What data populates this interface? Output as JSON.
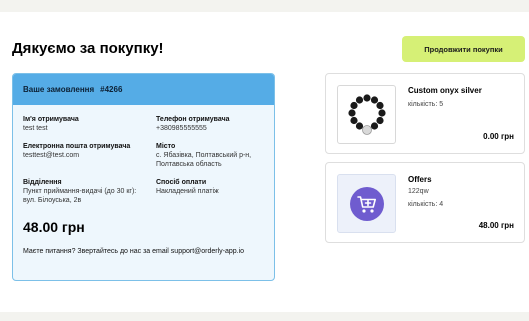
{
  "header": {
    "title": "Дякуємо за покупку!",
    "continue_label": "Продовжити покупки"
  },
  "order": {
    "heading": "Ваше замовлення",
    "number": "#4266",
    "recipient_label": "Ім'я отримувача",
    "recipient_value": "test test",
    "phone_label": "Телефон отримувача",
    "phone_value": "+380985555555",
    "email_label": "Електронна пошта отримувача",
    "email_value": "testtest@test.com",
    "city_label": "Місто",
    "city_value": "с. Ябазівка, Полтавський р-н, Полтавська область",
    "branch_label": "Відділення",
    "branch_value": "Пункт приймання-видачі (до 30 кг): вул. Білоуська, 2в",
    "payment_label": "Спосіб оплати",
    "payment_value": "Накладений платіж",
    "total": "48.00 грн",
    "help_text": "Маєте питання? Звертайтесь до нас за email support@orderly-app.io"
  },
  "products": [
    {
      "name": "Custom onyx silver",
      "qty_text": "кількість: 5",
      "price": "0.00 грн",
      "icon": "bracelet-image"
    },
    {
      "name": "Offers",
      "extra": "122qw",
      "qty_text": "кількість: 4",
      "price": "48.00 грн",
      "icon": "cart-plus-icon"
    }
  ],
  "colors": {
    "accent_green": "#d6f076",
    "header_blue": "#55ace6",
    "card_blue": "#eef7fd",
    "icon_purple": "#6f5ccf"
  }
}
